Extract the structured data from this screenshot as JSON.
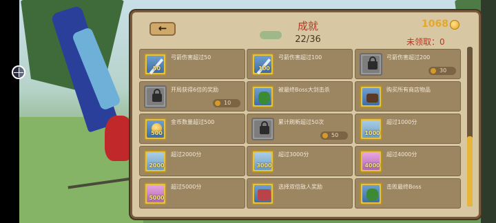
{
  "panel": {
    "back_glyph": "←",
    "title": "成就",
    "progress": "22/36",
    "gold": "1068",
    "unclaimed": "未领取：0"
  },
  "icons": {
    "back": "back-arrow-icon",
    "coin": "gold-coin-icon",
    "lock": "lock-icon"
  },
  "achievements": [
    {
      "label": "弓箭伤害超过50",
      "icon": "sword-icon",
      "icon_value": "50",
      "locked": false,
      "reward": ""
    },
    {
      "label": "弓箭伤害超过100",
      "icon": "sword-icon",
      "icon_value": "100",
      "locked": false,
      "reward": ""
    },
    {
      "label": "弓箭伤害超过200",
      "icon": "lock-icon",
      "icon_value": "",
      "locked": true,
      "reward": "30"
    },
    {
      "label": "开局获得6倍的奖励",
      "icon": "lock-icon",
      "icon_value": "",
      "locked": true,
      "reward": "10"
    },
    {
      "label": "被最终Boss大剑击杀",
      "icon": "boss-icon",
      "icon_value": "",
      "locked": false,
      "reward": ""
    },
    {
      "label": "购买所有商店物品",
      "icon": "shop-icon",
      "icon_value": "",
      "locked": false,
      "reward": ""
    },
    {
      "label": "金币数量超过500",
      "icon": "coin-icon",
      "icon_value": "500",
      "locked": false,
      "reward": ""
    },
    {
      "label": "累计刷新超过50次",
      "icon": "lock-icon",
      "icon_value": "",
      "locked": true,
      "reward": "50"
    },
    {
      "label": "超过1000分",
      "icon": "score-icon",
      "icon_value": "1000",
      "locked": false,
      "reward": ""
    },
    {
      "label": "超过2000分",
      "icon": "score-icon",
      "icon_value": "2000",
      "locked": false,
      "reward": ""
    },
    {
      "label": "超过3000分",
      "icon": "score-icon",
      "icon_value": "3000",
      "locked": false,
      "reward": ""
    },
    {
      "label": "超过4000分",
      "icon": "score-pink-icon",
      "icon_value": "4000",
      "locked": false,
      "reward": ""
    },
    {
      "label": "超过5000分",
      "icon": "score-pink-icon",
      "icon_value": "5000",
      "locked": false,
      "reward": ""
    },
    {
      "label": "选择双倍敌人奖励",
      "icon": "enemy-icon",
      "icon_value": "",
      "locked": false,
      "reward": ""
    },
    {
      "label": "击败最终Boss",
      "icon": "boss-icon",
      "icon_value": "",
      "locked": false,
      "reward": ""
    }
  ]
}
